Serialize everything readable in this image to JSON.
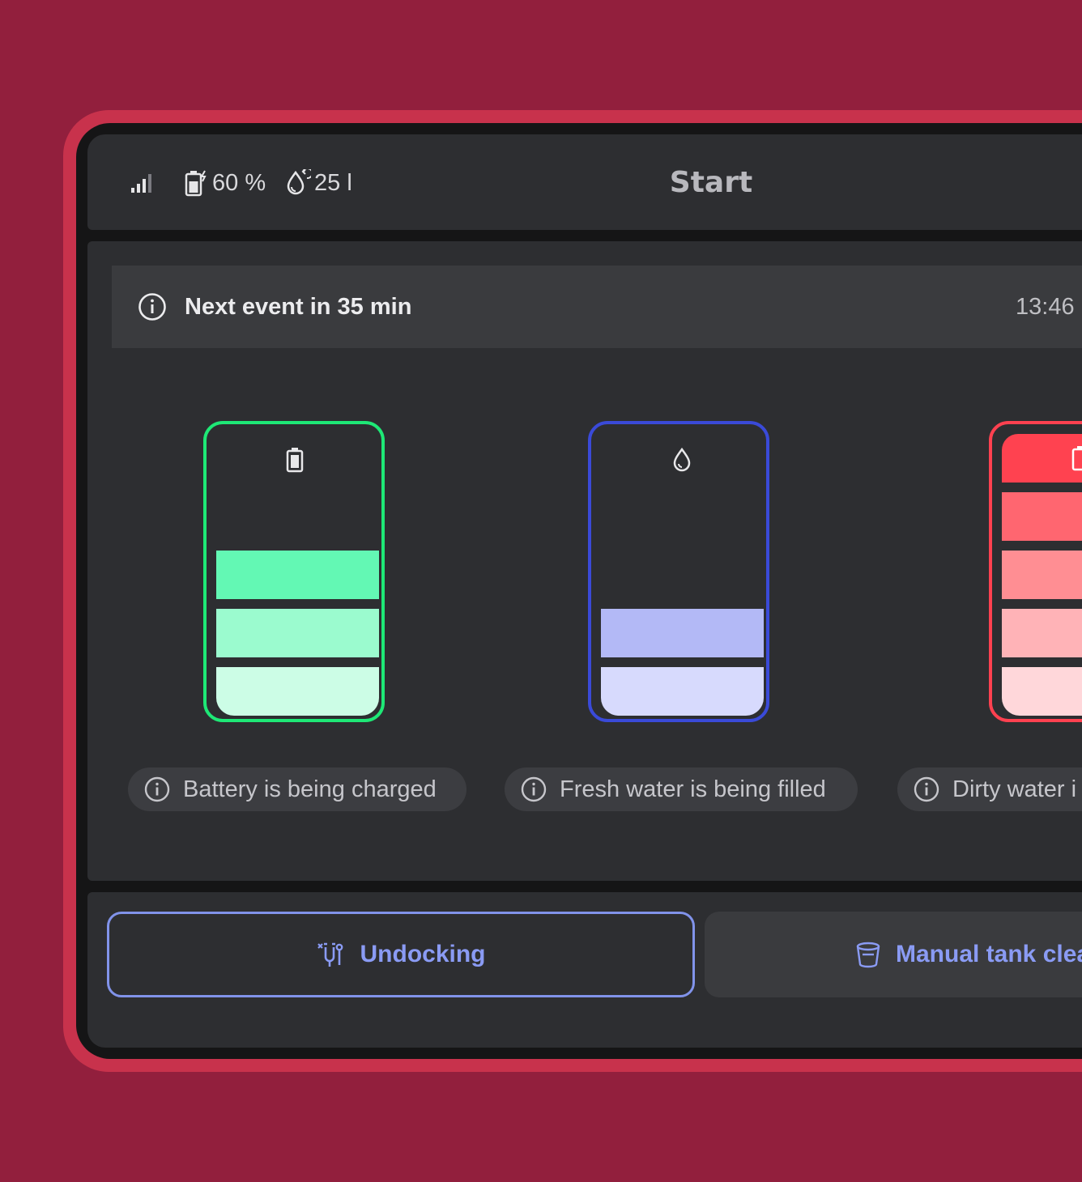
{
  "status_bar": {
    "signal_icon": "signal-bars-icon",
    "battery_icon": "battery-charging-icon",
    "battery_percent": "60 %",
    "water_icon": "water-drop-icon",
    "water_volume": "25 l",
    "title": "Start"
  },
  "event": {
    "icon": "info-icon",
    "text": "Next event in 35 min",
    "time": "13:46"
  },
  "tanks": [
    {
      "name": "battery",
      "icon": "battery-icon",
      "color": "#1ee876",
      "level_segments_filled": 3,
      "status": "Battery is being charged"
    },
    {
      "name": "fresh-water",
      "icon": "water-drop-icon",
      "color": "#3a4ad8",
      "level_segments_filled": 2,
      "status": "Fresh water is being filled"
    },
    {
      "name": "dirty-water",
      "icon": "tank-icon",
      "color": "#ff4150",
      "level_segments_filled": 5,
      "status": "Dirty water i"
    }
  ],
  "actions": {
    "undocking_icon": "undocking-icon",
    "undocking_label": "Undocking",
    "manual_clean_icon": "bucket-icon",
    "manual_clean_label": "Manual tank clea"
  },
  "colors": {
    "background": "#921f3d",
    "frame": "#c8324c",
    "panel": "#2d2e31",
    "accent": "#8a9bf4"
  }
}
